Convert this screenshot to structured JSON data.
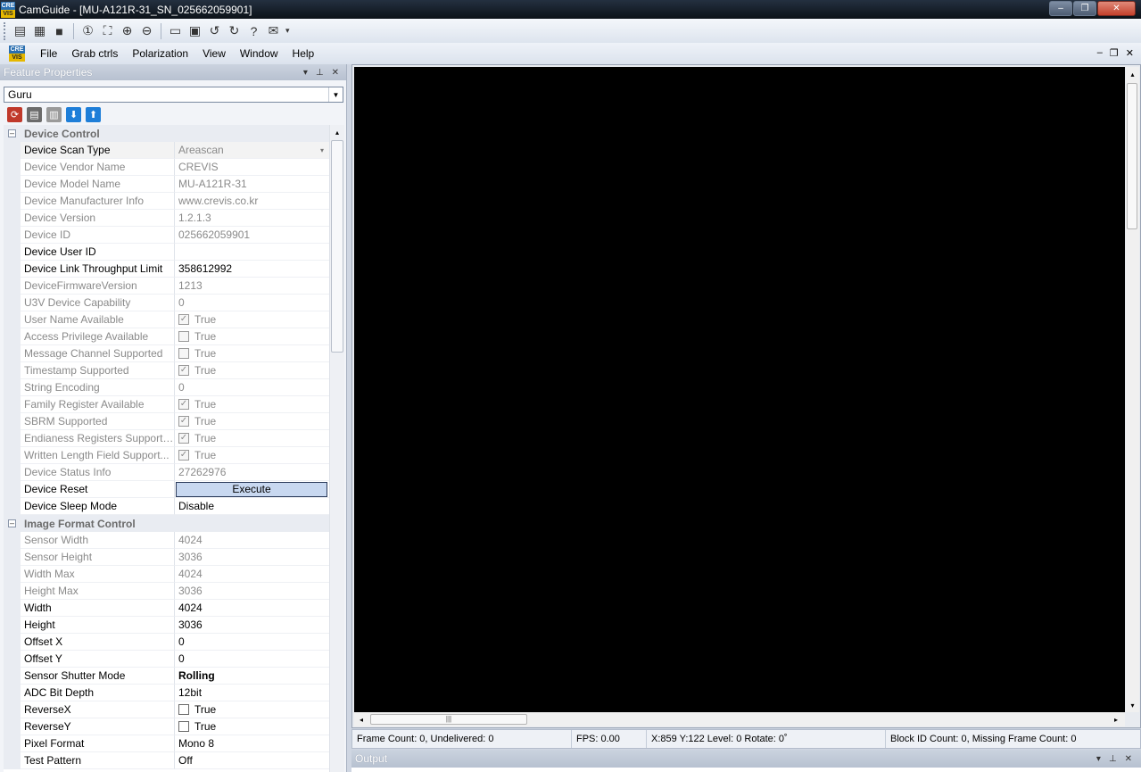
{
  "window": {
    "title": "CamGuide - [MU-A121R-31_SN_025662059901]",
    "logo_top": "CRE",
    "logo_bottom": "VIS",
    "minimize": "–",
    "restore": "❐",
    "close": "✕"
  },
  "toolbar": {
    "icons": [
      "grab-single-icon",
      "grab-continuous-icon",
      "stop-icon",
      "zoom-1-1-icon",
      "zoom-fit-icon",
      "zoom-in-icon",
      "zoom-out-icon",
      "save-icon",
      "save-all-icon",
      "rotate-left-icon",
      "rotate-right-icon",
      "help-icon",
      "settings-icon"
    ],
    "glyphs": [
      "▤",
      "▦",
      "■",
      "①",
      "⛶",
      "⊕",
      "⊖",
      "▭",
      "▣",
      "↺",
      "↻",
      "?",
      "✉"
    ],
    "more": "▾"
  },
  "menu": {
    "items": [
      "File",
      "Grab ctrls",
      "Polarization",
      "View",
      "Window",
      "Help"
    ],
    "mdi": [
      "–",
      "❐",
      "✕"
    ]
  },
  "feature_panel": {
    "title": "Feature Properties",
    "header_ctrls": [
      "▾",
      "⊥",
      "✕"
    ],
    "visibility": "Guru",
    "combo_arrow": "▼"
  },
  "prop_tools": [
    {
      "name": "refresh-icon",
      "glyph": "⟳",
      "color": "#c0392b"
    },
    {
      "name": "export-icon",
      "glyph": "▤",
      "color": "#6b6b6b"
    },
    {
      "name": "import-icon",
      "glyph": "▥",
      "color": "#9a9a9a"
    },
    {
      "name": "download-icon",
      "glyph": "⬇",
      "color": "#1e7ed8"
    },
    {
      "name": "upload-icon",
      "glyph": "⬆",
      "color": "#1e7ed8"
    }
  ],
  "categories": [
    {
      "name": "Device Control",
      "toggle": "–",
      "rows": [
        {
          "name": "Device Scan Type",
          "value": "Areascan",
          "ro": false,
          "type": "dropdown",
          "selected": true,
          "value_ro": true
        },
        {
          "name": "Device Vendor Name",
          "value": "CREVIS",
          "ro": true
        },
        {
          "name": "Device Model Name",
          "value": "MU-A121R-31",
          "ro": true
        },
        {
          "name": "Device Manufacturer Info",
          "value": "www.crevis.co.kr",
          "ro": true
        },
        {
          "name": "Device Version",
          "value": "1.2.1.3",
          "ro": true
        },
        {
          "name": "Device ID",
          "value": "025662059901",
          "ro": true
        },
        {
          "name": "Device User ID",
          "value": "",
          "ro": false
        },
        {
          "name": "Device Link Throughput Limit",
          "value": "358612992",
          "ro": false
        },
        {
          "name": "DeviceFirmwareVersion",
          "value": "1213",
          "ro": true
        },
        {
          "name": "U3V Device Capability",
          "value": "0",
          "ro": true
        },
        {
          "name": "User Name Available",
          "value": "True",
          "ro": true,
          "type": "checkbox",
          "checked": true
        },
        {
          "name": "Access Privilege Available",
          "value": "True",
          "ro": true,
          "type": "checkbox",
          "checked": false
        },
        {
          "name": "Message Channel Supported",
          "value": "True",
          "ro": true,
          "type": "checkbox",
          "checked": false
        },
        {
          "name": "Timestamp Supported",
          "value": "True",
          "ro": true,
          "type": "checkbox",
          "checked": true
        },
        {
          "name": "String Encoding",
          "value": "0",
          "ro": true
        },
        {
          "name": "Family Register Available",
          "value": "True",
          "ro": true,
          "type": "checkbox",
          "checked": true
        },
        {
          "name": "SBRM Supported",
          "value": "True",
          "ro": true,
          "type": "checkbox",
          "checked": true
        },
        {
          "name": "Endianess Registers Supported",
          "value": "True",
          "ro": true,
          "type": "checkbox",
          "checked": true
        },
        {
          "name": "Written Length Field Support...",
          "value": "True",
          "ro": true,
          "type": "checkbox",
          "checked": true
        },
        {
          "name": "Device Status Info",
          "value": "27262976",
          "ro": true
        },
        {
          "name": "Device Reset",
          "value": "Execute",
          "ro": false,
          "type": "button"
        },
        {
          "name": "Device Sleep Mode",
          "value": "Disable",
          "ro": false
        }
      ]
    },
    {
      "name": "Image Format Control",
      "toggle": "–",
      "rows": [
        {
          "name": "Sensor Width",
          "value": "4024",
          "ro": true
        },
        {
          "name": "Sensor Height",
          "value": "3036",
          "ro": true
        },
        {
          "name": "Width Max",
          "value": "4024",
          "ro": true
        },
        {
          "name": "Height Max",
          "value": "3036",
          "ro": true
        },
        {
          "name": "Width",
          "value": "4024",
          "ro": false
        },
        {
          "name": "Height",
          "value": "3036",
          "ro": false
        },
        {
          "name": "Offset X",
          "value": "0",
          "ro": false
        },
        {
          "name": "Offset Y",
          "value": "0",
          "ro": false
        },
        {
          "name": "Sensor Shutter Mode",
          "value": "Rolling",
          "ro": false,
          "bold": true
        },
        {
          "name": "ADC Bit Depth",
          "value": "12bit",
          "ro": false
        },
        {
          "name": "ReverseX",
          "value": "True",
          "ro": false,
          "type": "checkbox",
          "checked": false
        },
        {
          "name": "ReverseY",
          "value": "True",
          "ro": false,
          "type": "checkbox",
          "checked": false
        },
        {
          "name": "Pixel Format",
          "value": "Mono 8",
          "ro": false
        },
        {
          "name": "Test Pattern",
          "value": "Off",
          "ro": false
        }
      ]
    }
  ],
  "viewer": {
    "hscroll_thumb": "|||",
    "arrow_left": "◂",
    "arrow_right": "▸",
    "arrow_up": "▴",
    "arrow_down": "▾"
  },
  "status": {
    "frame_count": "Frame Count: 0, Undelivered: 0",
    "fps": "FPS: 0.00",
    "coords": "X:859  Y:122 Level: 0 Rotate: 0˚",
    "block_id": "Block ID Count: 0, Missing Frame Count: 0"
  },
  "output": {
    "title": "Output",
    "header_ctrls": [
      "▾",
      "⊥",
      "✕"
    ]
  },
  "colors": {
    "canvas": "#000000",
    "execute_button": "#c8d8f0"
  }
}
